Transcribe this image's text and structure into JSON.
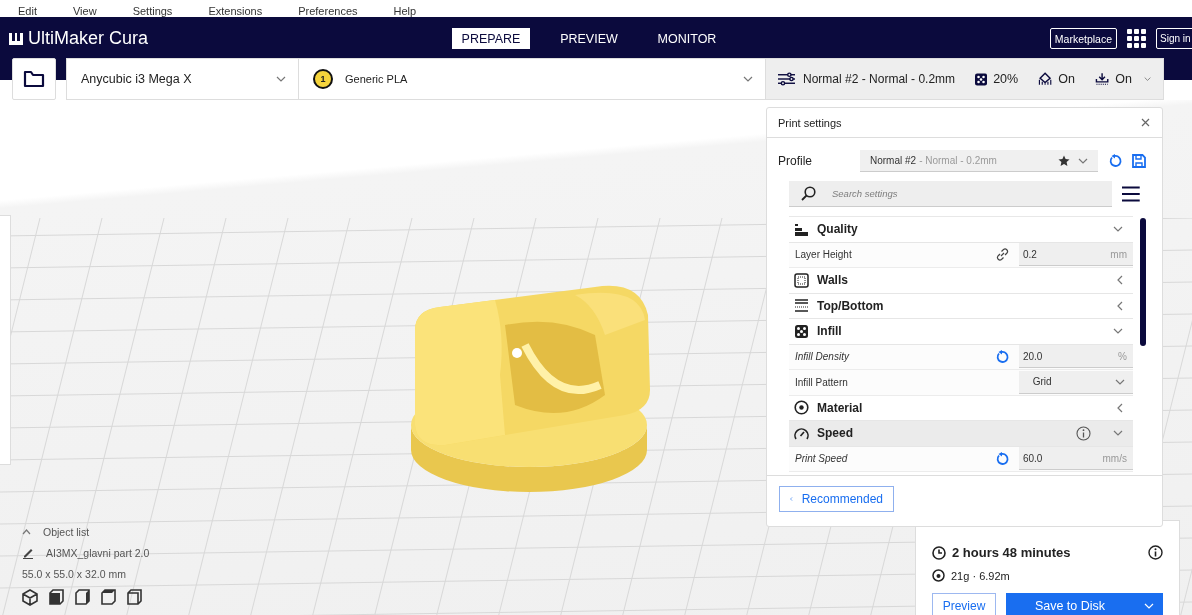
{
  "menu_bar": [
    {
      "label": "Edit"
    },
    {
      "label": "View"
    },
    {
      "label": "Settings"
    },
    {
      "label": "Extensions"
    },
    {
      "label": "Preferences"
    },
    {
      "label": "Help"
    }
  ],
  "app_title": "UltiMaker Cura",
  "stage_tabs": [
    {
      "label": "PREPARE",
      "selected": true
    },
    {
      "label": "PREVIEW",
      "selected": false
    },
    {
      "label": "MONITOR",
      "selected": false
    }
  ],
  "header_buttons": {
    "marketplace": "Marketplace",
    "sign_in": "Sign in"
  },
  "printer": {
    "name": "Anycubic i3 Mega X"
  },
  "material": {
    "extruder": "1",
    "name": "Generic PLA"
  },
  "print_summary": {
    "profile": "Normal #2 - Normal - 0.2mm",
    "infill": "20%",
    "support": "On",
    "adhesion": "On"
  },
  "print_settings": {
    "title": "Print settings",
    "profile_label": "Profile",
    "profile_name": "Normal #2",
    "profile_detail": "- Normal - 0.2mm",
    "search_placeholder": "Search settings",
    "categories": [
      {
        "label": "Quality",
        "expanded": true,
        "info": false,
        "hovered": false,
        "children": [
          {
            "label": "Layer Height",
            "modified": false,
            "linked": true,
            "kind": "text",
            "value": "0.2",
            "unit": "mm"
          }
        ]
      },
      {
        "label": "Walls",
        "expanded": false,
        "info": false,
        "hovered": false
      },
      {
        "label": "Top/Bottom",
        "expanded": false,
        "info": false,
        "hovered": false
      },
      {
        "label": "Infill",
        "expanded": true,
        "info": false,
        "hovered": false,
        "children": [
          {
            "label": "Infill Density",
            "modified": true,
            "linked": false,
            "kind": "text",
            "value": "20.0",
            "unit": "%"
          },
          {
            "label": "Infill Pattern",
            "modified": false,
            "linked": false,
            "kind": "dropdown",
            "value": "Grid"
          }
        ]
      },
      {
        "label": "Material",
        "expanded": false,
        "info": false,
        "hovered": false
      },
      {
        "label": "Speed",
        "expanded": true,
        "info": true,
        "hovered": true,
        "children": [
          {
            "label": "Print Speed",
            "modified": true,
            "linked": false,
            "kind": "text",
            "value": "60.0",
            "unit": "mm/s"
          }
        ]
      }
    ],
    "mode_button": "Recommended"
  },
  "object_list": {
    "title": "Object list",
    "object_name": "AI3MX_glavni part 2.0",
    "dimensions": "55.0 x 55.0 x 32.0 mm"
  },
  "estimate": {
    "time": "2 hours 48 minutes",
    "material": "21g · 6.92m",
    "preview_button": "Preview",
    "save_button": "Save to Disk"
  }
}
